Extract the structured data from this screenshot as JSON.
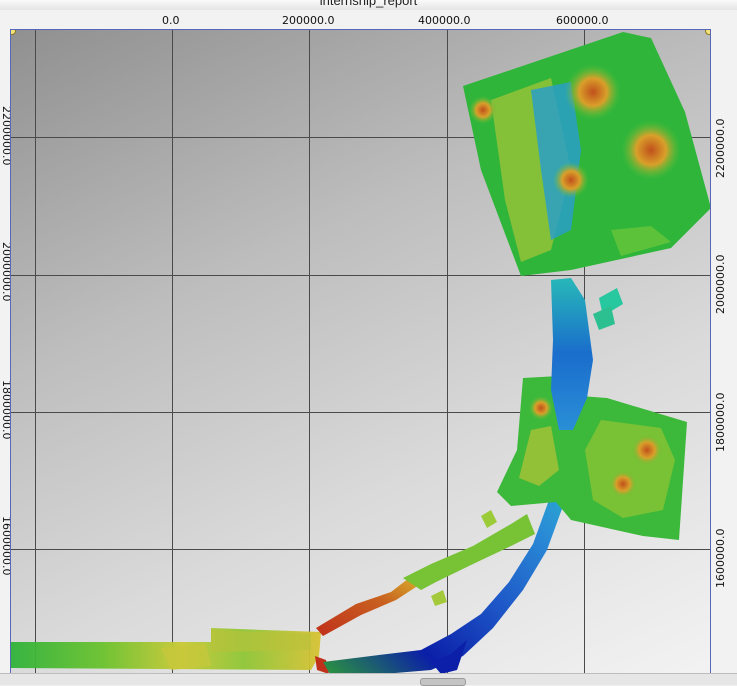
{
  "window": {
    "title": "internship_report"
  },
  "map": {
    "x_ticks": [
      "0.0",
      "200000.0",
      "400000.0",
      "600000.0"
    ],
    "y_ticks_right": [
      "2200000.0",
      "2000000.0",
      "1800000.0",
      "1600000.0"
    ],
    "y_ticks_left": [
      "2200000.0",
      "2000000.0",
      "1800000.0",
      "1600000.0"
    ],
    "colors": {
      "deep": "#0b1fa8",
      "shallow_blue": "#2a8fd6",
      "cyan": "#27c8c0",
      "green": "#1fb43a",
      "yellow": "#d6d22a",
      "orange": "#d98a1c",
      "red": "#c0301a",
      "frame": "#5866b8"
    }
  }
}
